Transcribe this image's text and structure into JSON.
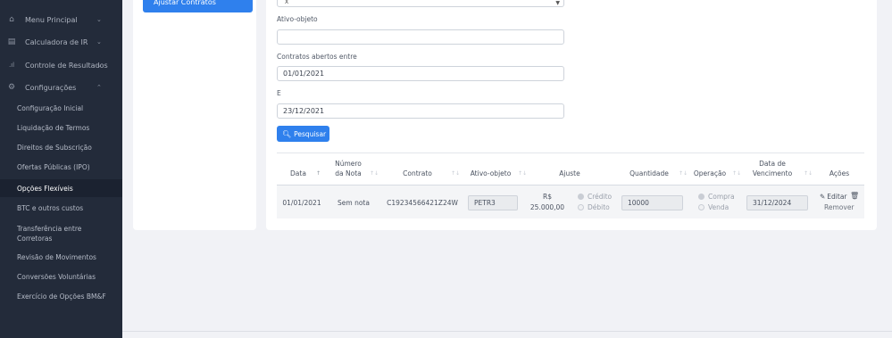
{
  "sidebar": {
    "menu": [
      {
        "label": "Menu Principal",
        "icon": "home-icon",
        "chevron": "⌄"
      },
      {
        "label": "Calculadora de IR",
        "icon": "document-icon",
        "chevron": "⌄"
      },
      {
        "label": "Controle de Resultados",
        "icon": "bar-chart-icon",
        "chevron": "⌄"
      },
      {
        "label": "Configurações",
        "icon": "gear-icon",
        "chevron": "⌃"
      }
    ],
    "submenu": [
      "Configuração Inicial",
      "Liquidação de Termos",
      "Direitos de Subscrição",
      "Ofertas Públicas (IPO)",
      "Opções Flexíveis",
      "BTC e outros custos",
      "Transferência entre Corretoras",
      "Revisão de Movimentos",
      "Conversões Voluntárias",
      "Exercício de Opções BM&F"
    ]
  },
  "ajustar_contratos": "Ajustar Contratos",
  "form": {
    "select_value": "X",
    "ativo_label": "Ativo-objeto",
    "ativo_value": "",
    "contratos_label": "Contratos abertos entre",
    "date_start": "01/01/2021",
    "e_label": "E",
    "date_end": "23/12/2021",
    "search_label": "Pesquisar"
  },
  "table": {
    "headers": {
      "data": "Data",
      "numero": "Número da Nota",
      "contrato": "Contrato",
      "ativo": "Ativo-objeto",
      "ajuste": "Ajuste",
      "quantidade": "Quantidade",
      "operacao": "Operação",
      "vencimento": "Data de Vencimento",
      "acoes": "Ações"
    },
    "row": {
      "data": "01/01/2021",
      "numero": "Sem nota",
      "contrato": "C19234566421Z24W",
      "ativo": "PETR3",
      "ajuste_currency": "R$",
      "ajuste_value": "25.000,00",
      "credito": "Crédito",
      "debito": "Débito",
      "quantidade": "10000",
      "compra": "Compra",
      "venda": "Venda",
      "vencimento": "31/12/2024",
      "editar": "Editar",
      "remover": "Remover"
    }
  },
  "colors": {
    "sidebar_bg": "#232b3a",
    "accent": "#2f80ed",
    "page_bg": "#f1f2f6"
  }
}
